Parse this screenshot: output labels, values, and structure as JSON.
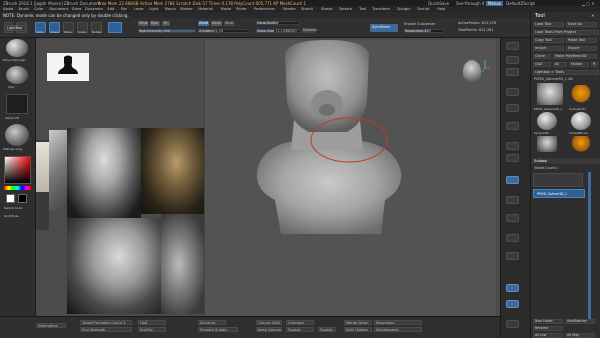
{
  "titlebar": {
    "app": "ZBrush 2018.1 [Jagdir Mosen]  ZBrush Document",
    "stats": "Free Mem 22.668GB  Active Mem 2784  Scratch Disk 57  Timer 0.178  PolyCount 605,771 KP  MeshCount 1",
    "quicksave": "QuickSave",
    "see_through": "See-through 0",
    "menus_label": "Menus",
    "script_label": "DefaultZScript"
  },
  "menubar": {
    "items": [
      "Alpha",
      "Brush",
      "Color",
      "Document",
      "Draw",
      "Dynamics",
      "Edit",
      "File",
      "Layer",
      "Light",
      "Macro",
      "Marker",
      "Material",
      "Movie",
      "Picker",
      "Preferences",
      "Render",
      "Stencil",
      "Stroke",
      "Texture",
      "Tool",
      "Transform",
      "Zplugin",
      "Zscript",
      "Help"
    ]
  },
  "note": "NOTE: Dynamic mode can be changed only by double clicking.",
  "toolbar": {
    "edit": "Edit",
    "draw": "Draw",
    "move": "Move",
    "scale": "Scale",
    "rotate": "Rotate",
    "mrgb": "Mrgb",
    "rgb": "Rgb",
    "m": "M",
    "zadd": "Zadd",
    "zsub": "Zsub",
    "zcut": "Zcut",
    "rgb_intensity": "Rgb Intensity 100",
    "z_intensity": "Z Intensity 25",
    "focal_shift": "Focal Shift 0",
    "draw_size": "Draw Size 111.686283",
    "dynamic": "Dynamic",
    "symmetry": "SymMirror",
    "enable_customize": "Enable Customize",
    "resolution": "Resolution 150",
    "active_points": "ActivePoints: 612,278",
    "total_points": "TotalPoints: 612,361"
  },
  "leftshelf": {
    "labels": [
      "LightBox",
      "Move Topologic",
      "Clay",
      "Alpha Off",
      "MatCap Gray",
      "Switch Color",
      "GridMode"
    ]
  },
  "toolpanel": {
    "title": "Tool",
    "rows": [
      "Load Tool",
      "Save As",
      "Load Tools From Project",
      "Copy Tool",
      "Paste Tool",
      "Import",
      "Export",
      "Clone",
      "Make PolyMesh3D",
      "GoZ",
      "All",
      "Visible",
      "R",
      "Lightbox > Tools"
    ],
    "current_tool": "PM3D_Sphere3D_1 48",
    "thumbs": [
      "PM3D_Sphere3D_1",
      "Cylinder3D",
      "Sphere3D",
      "SimpleBrush",
      "Sphere3D",
      "PM3D_Sphere3D_1"
    ],
    "subtool_header": "Subtool",
    "visible_count": "Visible Count 1",
    "subtool_item": "PM3D_Sphere3D_1",
    "bottom_rows": [
      "New Folder",
      "Rename",
      "AutoReorder",
      "All Low",
      "All High"
    ]
  },
  "bottombar": {
    "cells": [
      "Alternative",
      "Target Polygons Count 5",
      "Proj Strength",
      "Half",
      "SubDiv",
      "Dynamic",
      "Smooth Subdiv",
      "Groups Split",
      "Keep Groups",
      "Zremesh",
      "Groups Split",
      "Merge Down",
      "Resolution",
      "MultiAppend",
      "Split Hidden",
      "Close Holes",
      "Double",
      "Smt Boundary"
    ]
  },
  "colors": {
    "accent_blue": "#3e6a9c",
    "toolbar_active": "#2f5f94",
    "brush_ring": "#c0392b"
  }
}
